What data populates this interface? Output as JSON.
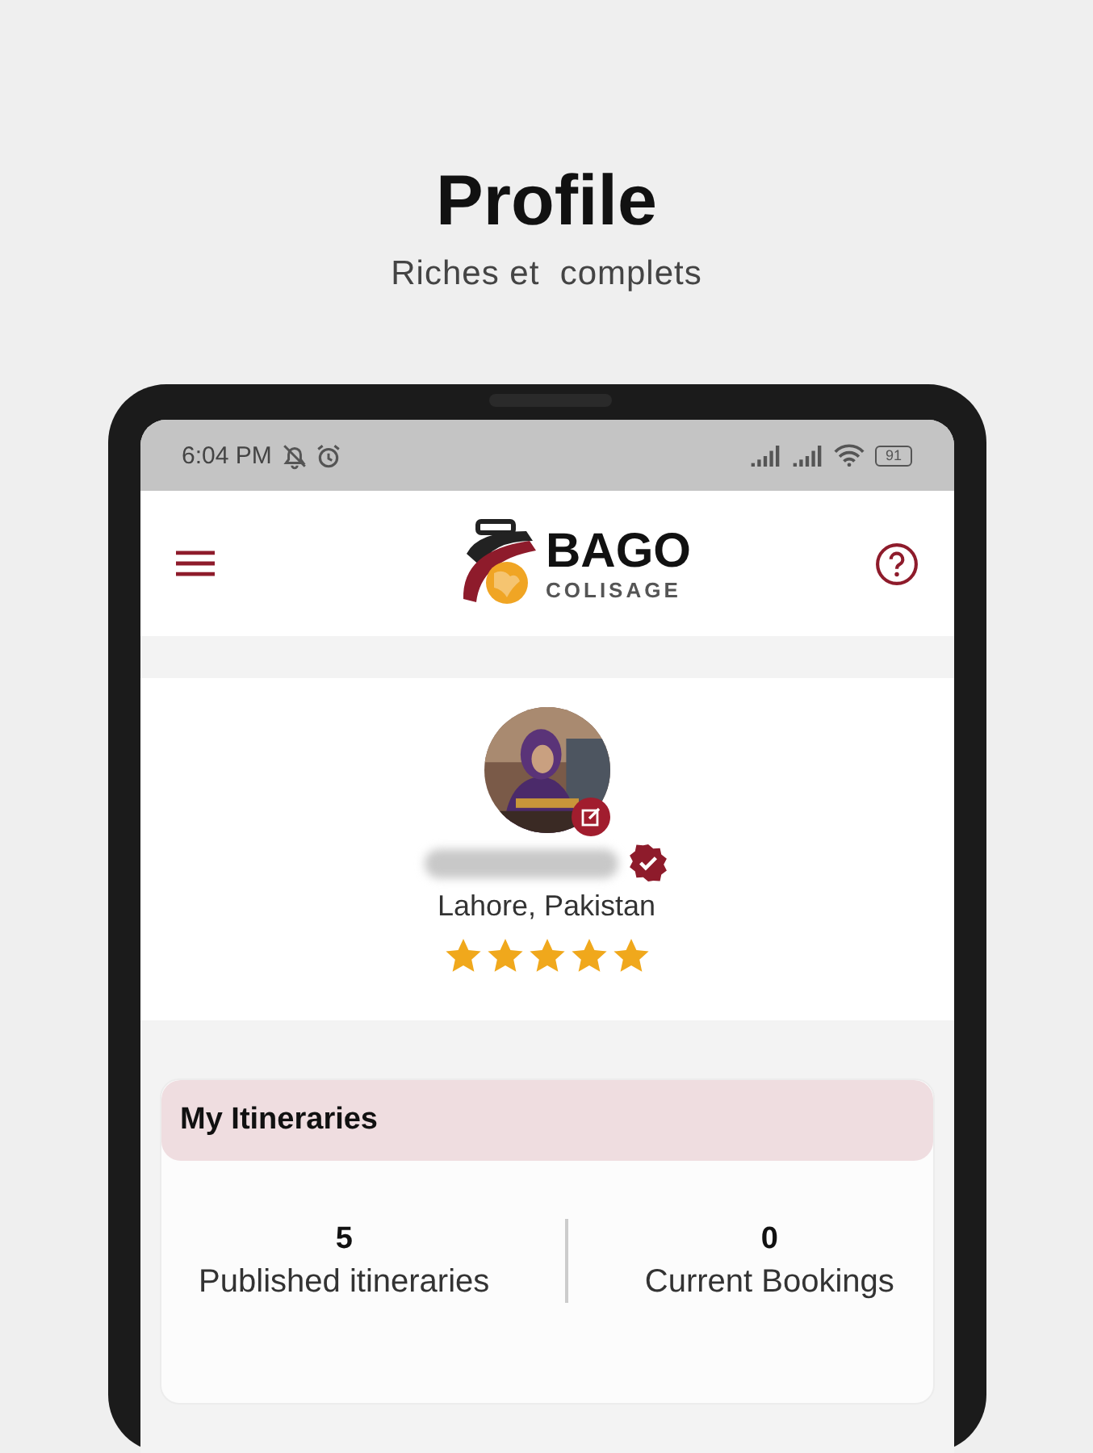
{
  "heading": {
    "title": "Profile",
    "subtitle": "Riches et  complets"
  },
  "status_bar": {
    "time": "6:04 PM",
    "battery": "91"
  },
  "app_bar": {
    "logo_word": "BAGO",
    "logo_sub": "COLISAGE"
  },
  "profile": {
    "location": "Lahore, Pakistan",
    "verified": true,
    "stars": 5
  },
  "itineraries": {
    "title": "My Itineraries",
    "stats": [
      {
        "value": "5",
        "label": "Published itineraries"
      },
      {
        "value": "0",
        "label": "Current Bookings"
      }
    ]
  }
}
